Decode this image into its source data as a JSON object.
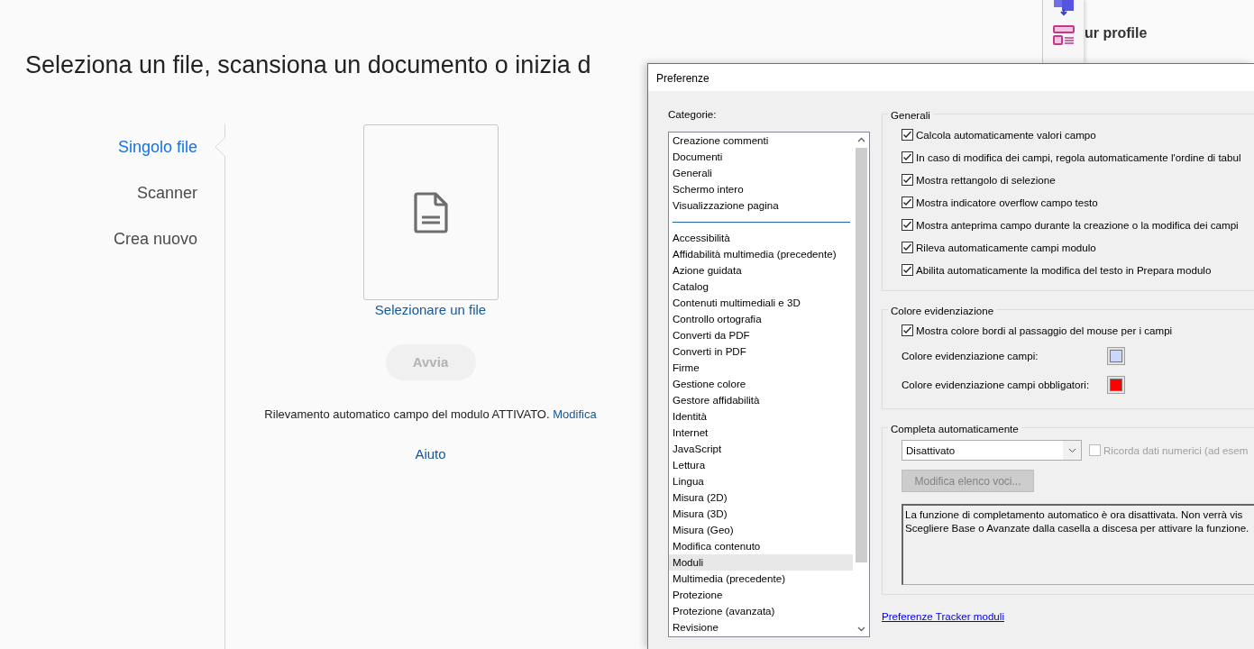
{
  "page": {
    "heading": "Seleziona un file, scansiona un documento o inizia d",
    "nav": [
      {
        "label": "Singolo file",
        "selected": true
      },
      {
        "label": "Scanner",
        "selected": false
      },
      {
        "label": "Crea nuovo",
        "selected": false
      }
    ],
    "file_link": "Selezionare un file",
    "start_button": {
      "label": "Avvia",
      "disabled": true
    },
    "status_text": "Rilevamento automatico campo del modulo ATTIVATO.",
    "status_link": "Modifica",
    "help_link": "Aiuto",
    "profile_text": "ur profile"
  },
  "dialog": {
    "title": "Preferenze",
    "categories_label": "Categorie:",
    "category_groups": [
      {
        "items": [
          {
            "label": "Creazione commenti",
            "selected": false
          },
          {
            "label": "Documenti",
            "selected": false
          },
          {
            "label": "Generali",
            "selected": false
          },
          {
            "label": "Schermo intero",
            "selected": false
          },
          {
            "label": "Visualizzazione pagina",
            "selected": false
          }
        ]
      },
      {
        "items": [
          {
            "label": "Accessibilità",
            "selected": false
          },
          {
            "label": "Affidabilità multimedia (precedente)",
            "selected": false
          },
          {
            "label": "Azione guidata",
            "selected": false
          },
          {
            "label": "Catalog",
            "selected": false
          },
          {
            "label": "Contenuti multimediali e 3D",
            "selected": false
          },
          {
            "label": "Controllo ortografia",
            "selected": false
          },
          {
            "label": "Converti da PDF",
            "selected": false
          },
          {
            "label": "Converti in PDF",
            "selected": false
          },
          {
            "label": "Firme",
            "selected": false
          },
          {
            "label": "Gestione colore",
            "selected": false
          },
          {
            "label": "Gestore affidabilità",
            "selected": false
          },
          {
            "label": "Identità",
            "selected": false
          },
          {
            "label": "Internet",
            "selected": false
          },
          {
            "label": "JavaScript",
            "selected": false
          },
          {
            "label": "Lettura",
            "selected": false
          },
          {
            "label": "Lingua",
            "selected": false
          },
          {
            "label": "Misura (2D)",
            "selected": false
          },
          {
            "label": "Misura (3D)",
            "selected": false
          },
          {
            "label": "Misura (Geo)",
            "selected": false
          },
          {
            "label": "Modifica contenuto",
            "selected": false
          },
          {
            "label": "Moduli",
            "selected": true
          },
          {
            "label": "Multimedia (precedente)",
            "selected": false
          },
          {
            "label": "Protezione",
            "selected": false
          },
          {
            "label": "Protezione (avanzata)",
            "selected": false
          },
          {
            "label": "Revisione",
            "selected": false
          }
        ]
      }
    ],
    "general": {
      "title": "Generali",
      "options": [
        {
          "label": "Calcola automaticamente valori campo",
          "checked": true
        },
        {
          "label": "In caso di modifica dei campi, regola automaticamente l'ordine di tabul",
          "checked": true
        },
        {
          "label": "Mostra rettangolo di selezione",
          "checked": true
        },
        {
          "label": "Mostra indicatore overflow campo testo",
          "checked": true
        },
        {
          "label": "Mostra anteprima campo durante la creazione o la modifica dei campi",
          "checked": true
        },
        {
          "label": "Rileva automaticamente campi modulo",
          "checked": true
        },
        {
          "label": "Abilita automaticamente la modifica del testo in Prepara modulo",
          "checked": true
        }
      ]
    },
    "highlight": {
      "title": "Colore evidenziazione",
      "options": [
        {
          "kind": "checkbox",
          "label": "Mostra colore bordi al passaggio del mouse per i campi",
          "checked": true
        },
        {
          "kind": "color",
          "label": "Colore evidenziazione campi:",
          "color": "#cad6fa"
        },
        {
          "kind": "color",
          "label": "Colore evidenziazione campi obbligatori:",
          "color": "#ff0000"
        }
      ]
    },
    "autocomplete": {
      "title": "Completa automaticamente",
      "select_value": "Disattivato",
      "remember": {
        "label": "Ricorda dati numerici (ad esem",
        "checked": false,
        "disabled": true
      },
      "edit_button": {
        "label": "Modifica elenco voci...",
        "disabled": true
      },
      "description_lines": [
        "La funzione di completamento automatico è ora disattivata. Non verrà vis",
        "Scegliere Base o Avanzate dalla casella a discesa per attivare la funzione."
      ]
    },
    "tracker_link": "Preferenze Tracker moduli"
  }
}
